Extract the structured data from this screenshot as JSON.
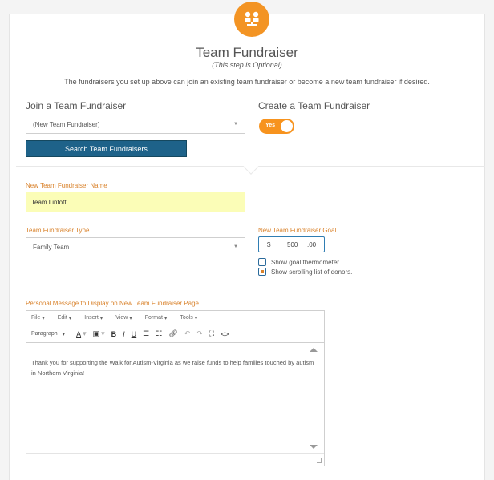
{
  "header": {
    "title": "Team Fundraiser",
    "subtitle": "(This step is Optional)",
    "description": "The fundraisers you set up above can join an existing team fundraiser or become a new team fundraiser if desired."
  },
  "join": {
    "heading": "Join a Team Fundraiser",
    "select_value": "(New Team Fundraiser)",
    "search_button": "Search Team Fundraisers"
  },
  "create": {
    "heading": "Create a Team Fundraiser",
    "toggle_label": "Yes"
  },
  "form": {
    "name_label": "New Team Fundraiser Name",
    "name_value": "Team Lintott",
    "type_label": "Team Fundraiser Type",
    "type_value": "Family Team",
    "goal_label": "New Team Fundraiser Goal",
    "goal_currency": "$",
    "goal_amount": "500",
    "goal_cents": ".00",
    "show_thermometer": "Show goal thermometer.",
    "show_donors": "Show scrolling list of donors."
  },
  "editor": {
    "label": "Personal Message to Display on New Team Fundraiser Page",
    "menus": [
      "File",
      "Edit",
      "Insert",
      "View",
      "Format",
      "Tools"
    ],
    "paragraph": "Paragraph",
    "message": "Thank you for supporting the Walk for Autism-Virginia as we raise funds to help families touched by autism in Northern Virginia!"
  }
}
